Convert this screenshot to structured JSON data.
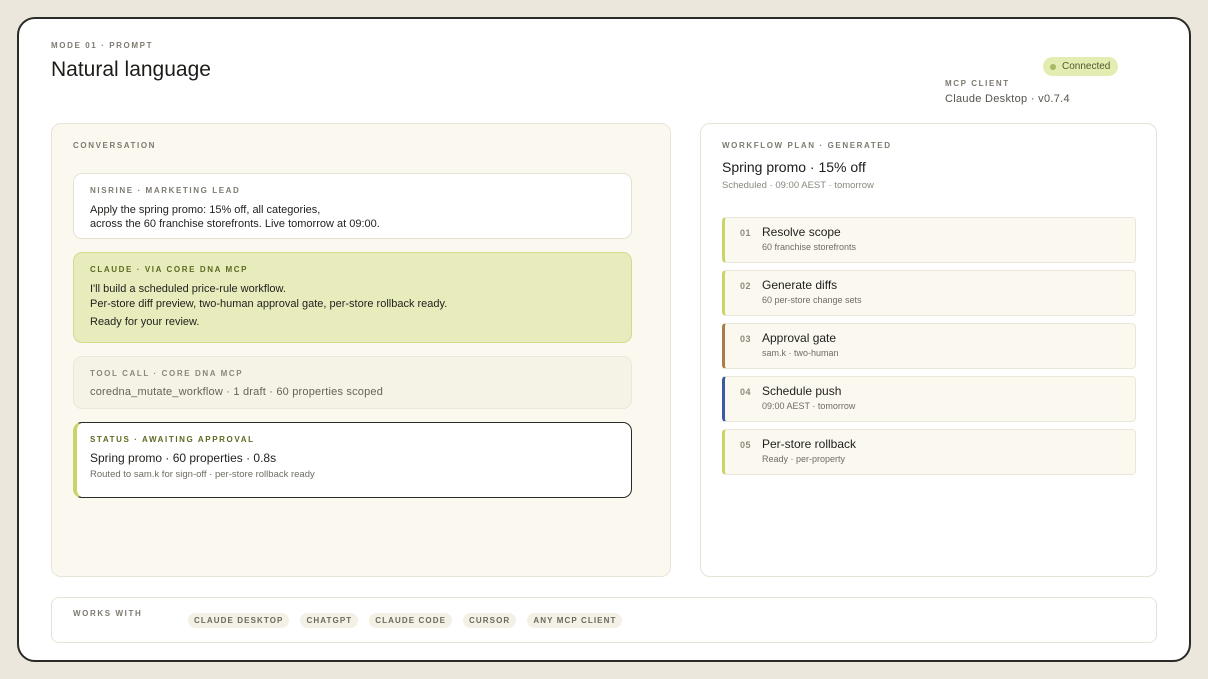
{
  "header": {
    "mode": "MODE 01 · PROMPT",
    "title": "Natural language",
    "status_badge": "Connected",
    "mcp_label": "MCP CLIENT",
    "mcp_value": "Claude Desktop · v0.7.4"
  },
  "conversation": {
    "title": "CONVERSATION",
    "messages": [
      {
        "who": "NISRINE · MARKETING LEAD",
        "lines": [
          "Apply the spring promo: 15% off, all categories,",
          "across the 60 franchise storefronts. Live tomorrow at 09:00."
        ]
      },
      {
        "who": "CLAUDE · VIA CORE DNA MCP",
        "lines": [
          "I'll build a scheduled price-rule workflow.",
          "Per-store diff preview, two-human approval gate, per-store rollback ready.",
          "Ready for your review."
        ]
      },
      {
        "who": "TOOL CALL · CORE DNA MCP",
        "lines": [
          "coredna_mutate_workflow · 1 draft · 60 properties scoped"
        ]
      },
      {
        "who": "STATUS · AWAITING APPROVAL",
        "lines": [
          "Spring promo · 60 properties · 0.8s",
          "Routed to sam.k for sign-off · per-store rollback ready"
        ]
      }
    ]
  },
  "plan": {
    "eyebrow": "WORKFLOW PLAN · GENERATED",
    "title": "Spring promo · 15% off",
    "subtitle": "Scheduled · 09:00 AEST · tomorrow",
    "steps": [
      {
        "num": "01",
        "name": "Resolve scope",
        "desc": "60 franchise storefronts",
        "accent": "#c9d566"
      },
      {
        "num": "02",
        "name": "Generate diffs",
        "desc": "60 per-store change sets",
        "accent": "#c9d566"
      },
      {
        "num": "03",
        "name": "Approval gate",
        "desc": "sam.k · two-human",
        "accent": "#a97d45"
      },
      {
        "num": "04",
        "name": "Schedule push",
        "desc": "09:00 AEST · tomorrow",
        "accent": "#3b5aa0"
      },
      {
        "num": "05",
        "name": "Per-store rollback",
        "desc": "Ready · per-property",
        "accent": "#c9d566"
      }
    ]
  },
  "works_with": {
    "label": "WORKS WITH",
    "clients": [
      "CLAUDE DESKTOP",
      "CHATGPT",
      "CLAUDE CODE",
      "CURSOR",
      "ANY MCP CLIENT"
    ]
  },
  "colors": {
    "accent_green": "#c9d566",
    "accent_brown": "#a97d45",
    "accent_blue": "#3b5aa0",
    "badge_bg": "#e3ecb1",
    "claude_bubble": "#e8ecbc"
  }
}
